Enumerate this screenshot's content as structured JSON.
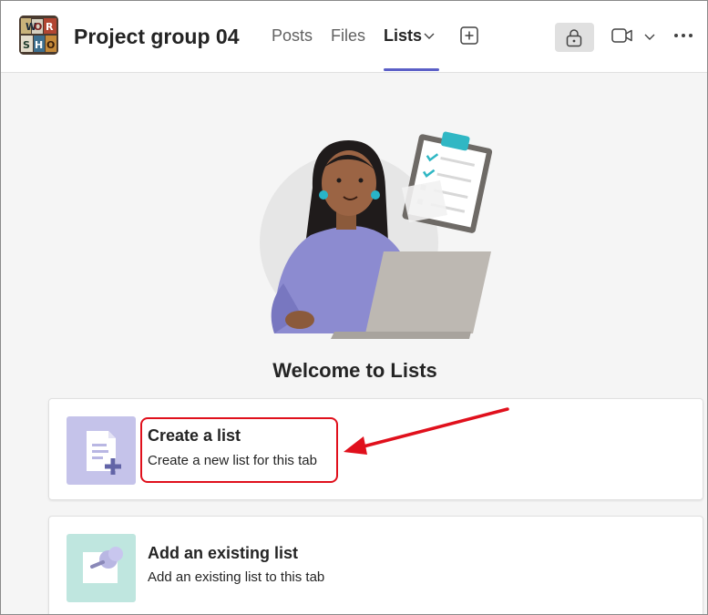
{
  "header": {
    "team_name": "Project group 04",
    "tabs": [
      {
        "label": "Posts",
        "active": false
      },
      {
        "label": "Files",
        "active": false
      },
      {
        "label": "Lists",
        "active": true
      }
    ],
    "accent_color": "#5b5fc7"
  },
  "icons": {
    "lists_dropdown": "chevron-down-icon",
    "add_tab": "add-tab-icon",
    "lock": "lock-icon",
    "video": "video-camera-icon",
    "video_dropdown": "chevron-down-icon",
    "more": "more-options-icon"
  },
  "main": {
    "welcome_title": "Welcome to Lists",
    "cards": [
      {
        "title": "Create a list",
        "description": "Create a new list for this tab",
        "icon": "new-list-icon",
        "icon_bg": "#c5c3ea"
      },
      {
        "title": "Add an existing list",
        "description": "Add an existing list to this tab",
        "icon": "pin-list-icon",
        "icon_bg": "#bfe6df"
      }
    ]
  },
  "annotation": {
    "highlight_color": "#e0101c"
  }
}
